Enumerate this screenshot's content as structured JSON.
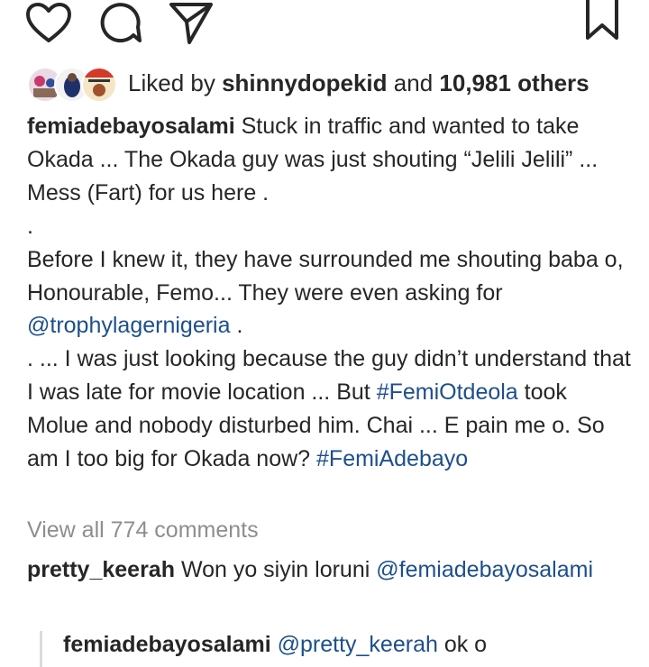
{
  "actions": {
    "like_icon": "heart-outline",
    "comment_icon": "speech-bubble-outline",
    "share_icon": "paper-plane-outline",
    "save_icon": "bookmark-outline"
  },
  "likes": {
    "prefix": "Liked by",
    "user": "shinnydopekid",
    "and": "and",
    "count": "10,981 others"
  },
  "caption": {
    "author": "femiadebayosalami",
    "text1": "Stuck in traffic and wanted to take Okada ... The Okada guy was just shouting “Jelili Jelili” ... Mess (Fart) for us here .",
    "dot": ".",
    "text2a": "Before I knew it, they have surrounded me shouting baba o, Honourable, Femo... They were even asking for",
    "mention": "@trophylagernigeria",
    "text2b": ".",
    "text3a": ". ... I was just looking because the guy didn’t understand that I was late for movie location ... But",
    "hashtag1": "#FemiOtdeola",
    "text3b": "took Molue and nobody disturbed him. Chai ... E pain me o. So am I too big for Okada now?",
    "hashtag2": "#FemiAdebayo"
  },
  "view_all": "View all 774 comments",
  "comment": {
    "user": "pretty_keerah",
    "text": "Won yo siyin loruni",
    "mention": "@femiadebayosalami"
  },
  "reply": {
    "user": "femiadebayosalami",
    "mention": "@pretty_keerah",
    "text": "ok o"
  },
  "colors": {
    "link": "#1d4f8c",
    "muted": "#8e8e8e",
    "text": "#262626"
  }
}
